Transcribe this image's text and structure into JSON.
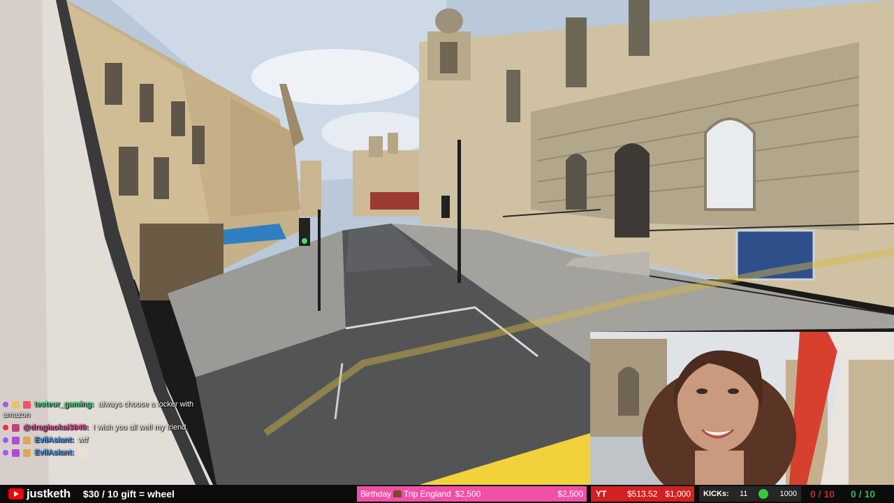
{
  "chat": {
    "messages": [
      {
        "user": "testeur_gaming:",
        "text": "always choose a locker with amazon",
        "user_color": "#3ddc84"
      },
      {
        "user": "@dragiaokai3840:",
        "text": "I wish you all well my friend.",
        "user_color": "#e0509f"
      },
      {
        "user": "EvilAsiant:",
        "text": "wtf",
        "user_color": "#4a9dff"
      },
      {
        "user": "EvilAsiant:",
        "text": "",
        "user_color": "#4a9dff"
      }
    ]
  },
  "bottom_bar": {
    "channel": "justketh",
    "gift_text": "$30 / 10 gift = wheel",
    "goal": {
      "label": "Birthday",
      "label2": "Trip England",
      "value": "$2,500",
      "target": "$2,500"
    },
    "youtube": {
      "label": "YT",
      "value": "$513.52",
      "goal": "$1,000"
    },
    "kick": {
      "label": "KICKs:",
      "value": "11",
      "goal": "1000"
    },
    "sub_count_1": "0 / 10",
    "sub_count_2": "0 / 10"
  },
  "colors": {
    "goal_bg": "#f24fa7",
    "yt_bg": "#d32020",
    "kick_bg": "#262626",
    "kick_icon": "#38c93b",
    "sub1": "#b83030",
    "sub2": "#37b64a"
  }
}
